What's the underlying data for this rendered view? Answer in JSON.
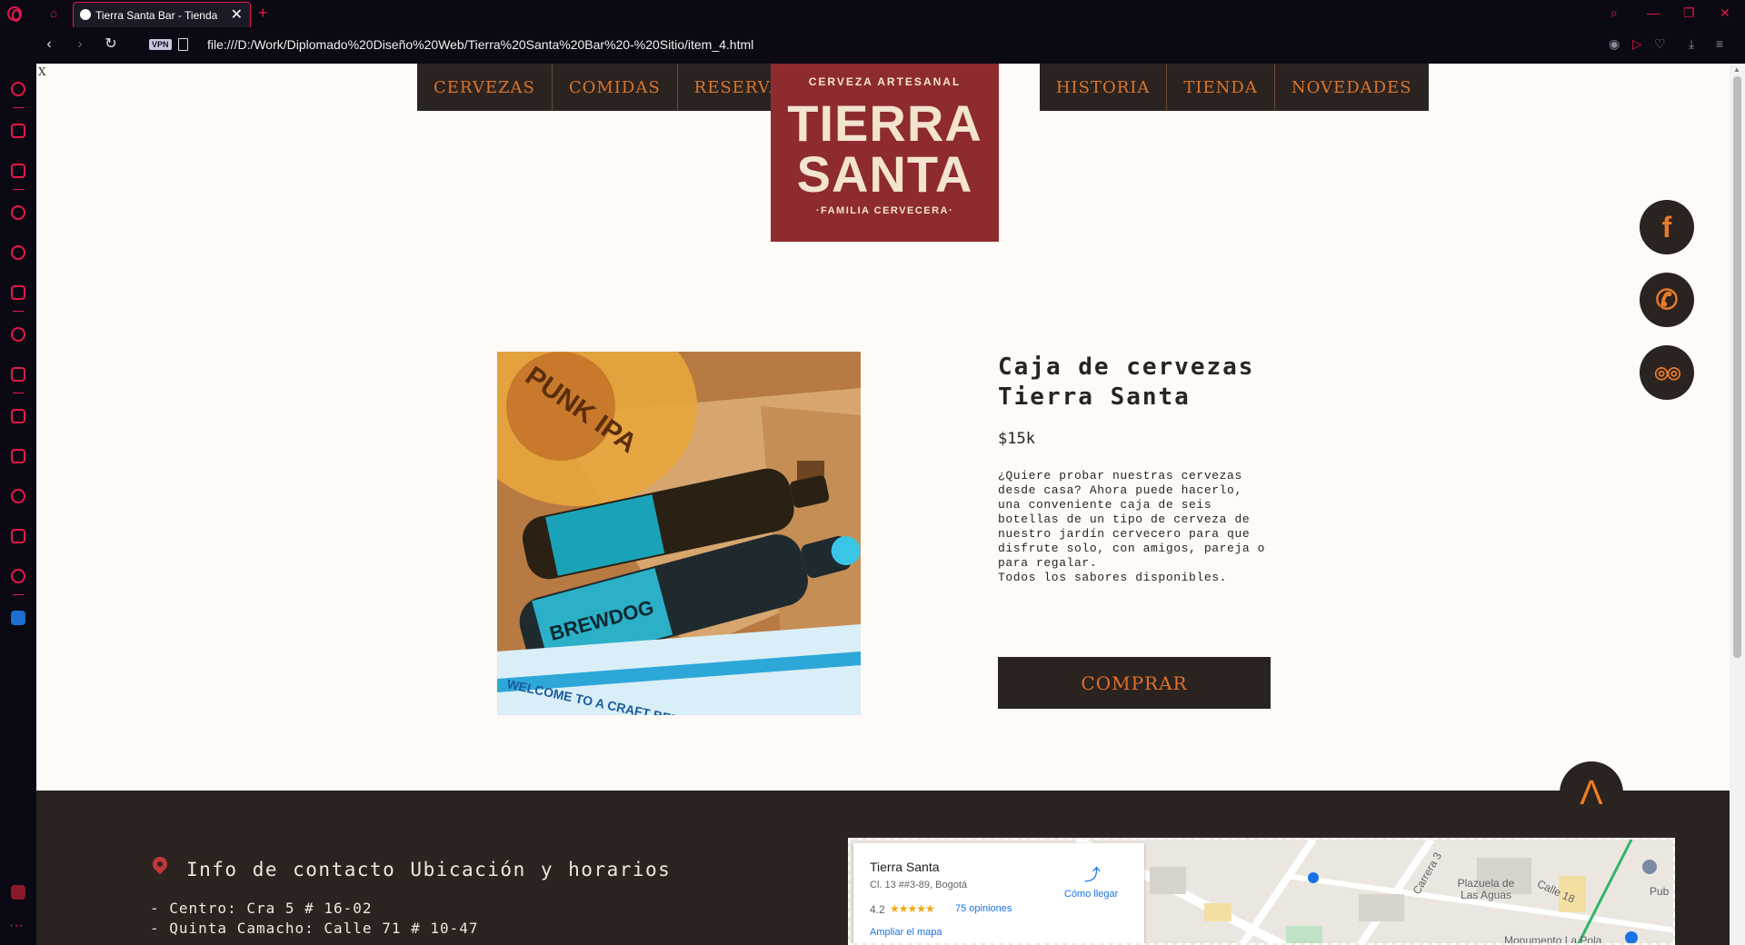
{
  "browser": {
    "tab_title": "Tierra Santa Bar - Tienda",
    "url": "file:///D:/Work/Diplomado%20Diseño%20Web/Tierra%20Santa%20Bar%20-%20Sitio/item_4.html",
    "vpn_label": "VPN",
    "new_tab": "+",
    "close_tab": "✕"
  },
  "page": {
    "corner_mark": "X",
    "nav_left": [
      "CERVEZAS",
      "COMIDAS",
      "RESERVAS"
    ],
    "nav_right": [
      "HISTORIA",
      "TIENDA",
      "NOVEDADES"
    ],
    "logo": {
      "top": "CERVEZA ARTESANAL",
      "line1": "TIERRA",
      "line2": "SANTA",
      "bottom": "·FAMILIA CERVECERA·"
    },
    "social": [
      {
        "icon": "facebook-icon",
        "glyph": "f"
      },
      {
        "icon": "phone-icon",
        "glyph": "✆"
      },
      {
        "icon": "tripadvisor-icon",
        "glyph": "◎◎"
      }
    ],
    "back_to_top": "Λ"
  },
  "product": {
    "title": "Caja de cervezas Tierra Santa",
    "price": "$15k",
    "description": "¿Quiere probar nuestras cervezas desde casa? Ahora puede hacerlo, una conveniente caja de seis botellas de un tipo de cerveza de nuestro jardín cervecero para que disfrute solo, con amigos, pareja o para regalar.",
    "availability": "Todos los sabores disponibles.",
    "buy_label": "COMPRAR",
    "image_text": {
      "can_brand": "PUNK IPA",
      "bottle_brand": "BREWDOG",
      "box_text": "WELCOME TO A CRAFT BEER REVOLUTION"
    }
  },
  "footer": {
    "contact_title": "Info de contacto Ubicación y horarios",
    "addresses": [
      "- Centro: Cra 5 # 16-02",
      "- Quinta Camacho: Calle 71 # 10-47"
    ]
  },
  "map": {
    "place_name": "Tierra Santa",
    "place_address": "Cl. 13 ##3-89, Bogotá",
    "rating": "4.2",
    "stars": "★★★★★",
    "reviews": "75 opiniones",
    "directions": "Cómo llegar",
    "enlarge": "Ampliar el mapa",
    "labels": [
      "Carrera 3",
      "Plazuela de Las Aguas",
      "Calle 18",
      "Pub",
      "Monumento La Pola"
    ]
  }
}
